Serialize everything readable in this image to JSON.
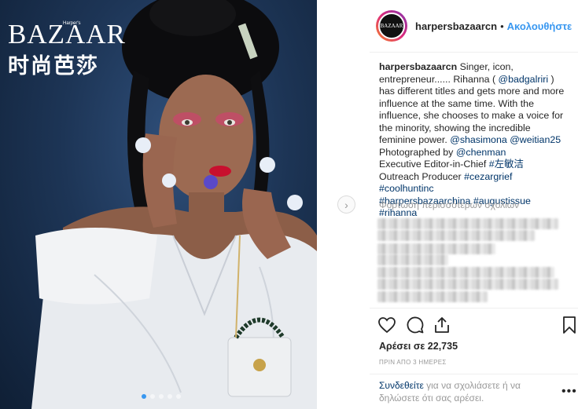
{
  "post": {
    "magazine_logo": "BAZAAR",
    "magazine_logo_small": "Harper's",
    "magazine_logo_cn": "时尚芭莎",
    "carousel_dots": 5,
    "carousel_active": 0
  },
  "header": {
    "username": "harpersbazaarcn",
    "bullet": "•",
    "follow_label": "Ακολουθήστε",
    "avatar_text": "BAZAAR"
  },
  "caption": {
    "username": "harpersbazaarcn",
    "text1": " Singer, icon, entrepreneur...... Rihanna ( ",
    "mention1": "@badgalriri",
    "text2": " ) has different titles and gets more and more influence at the same time. With the influence, she chooses to make a voice for the minority, showing the incredible feminine power. ",
    "mention2": "@shasimona",
    "mention3": "@weitian25",
    "photographed_label": "Photographed by ",
    "mention4": "@chenman",
    "editor_label": "Executive Editor-in-Chief ",
    "tag1": "#左敏洁",
    "outreach_label": "Outreach Producer ",
    "tag2": "#cezargrief",
    "tag3": "#coolhuntinc",
    "tag4": "#harpersbazaarchina",
    "tag5": "#augustissue",
    "tag6": "#rihanna"
  },
  "comments": {
    "load_more": "Φόρτωση περισσότερων σχολίων"
  },
  "actions": {
    "like_icon": "heart-icon",
    "comment_icon": "comment-icon",
    "share_icon": "share-icon",
    "save_icon": "bookmark-icon"
  },
  "stats": {
    "likes": "Αρέσει σε 22,735",
    "time": "ΠΡΙΝ ΑΠΟ 3 ΗΜΕΡΕΣ"
  },
  "footer": {
    "login_link": "Συνδεθείτε",
    "login_text": " για να σχολιάσετε ή να δηλώσετε ότι σας αρέσει.",
    "more_label": "•••"
  }
}
